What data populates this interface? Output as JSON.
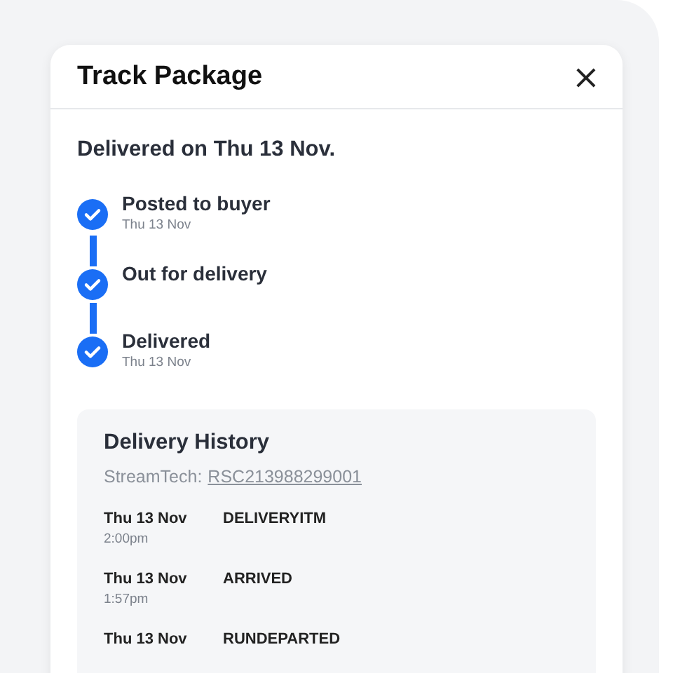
{
  "dialog": {
    "title": "Track Package",
    "close": "×"
  },
  "summary": "Delivered on Thu 13 Nov.",
  "steps": [
    {
      "label": "Posted to buyer",
      "date": "Thu 13 Nov",
      "completed": true
    },
    {
      "label": "Out for delivery",
      "completed": true
    },
    {
      "label": "Delivered",
      "date": "Thu 13 Nov",
      "completed": true
    }
  ],
  "history": {
    "title": "Delivery History",
    "carrier": "StreamTech:",
    "tracking_number": "RSC213988299001",
    "events": [
      {
        "date": "Thu 13 Nov",
        "time": "2:00pm",
        "status": "DELIVERYITM"
      },
      {
        "date": "Thu 13 Nov",
        "time": "1:57pm",
        "status": "ARRIVED"
      },
      {
        "date": "Thu 13 Nov",
        "status": "RUNDEPARTED"
      }
    ]
  }
}
